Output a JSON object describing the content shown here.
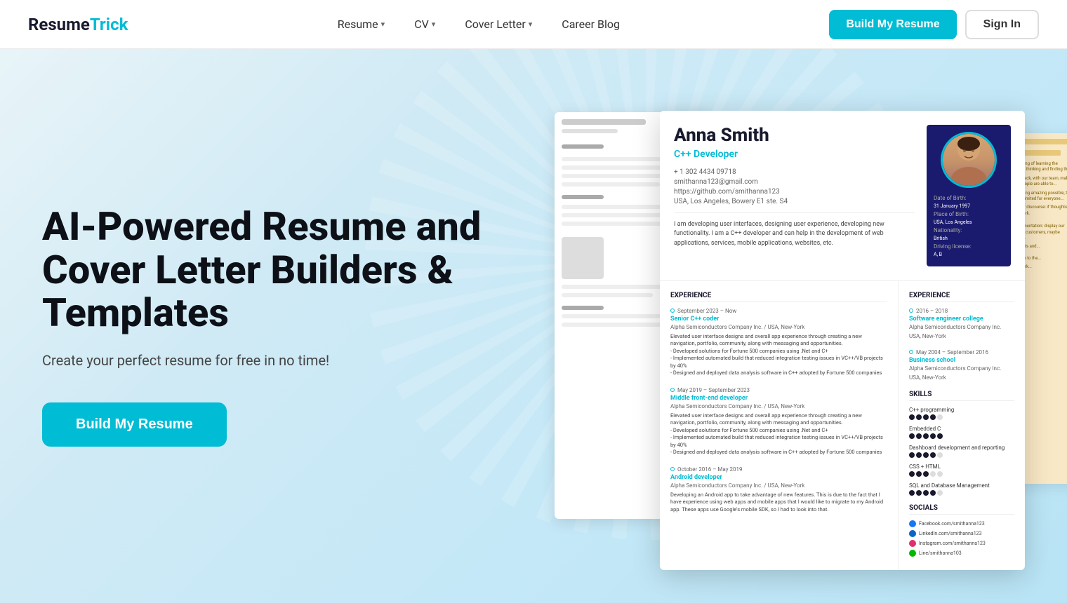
{
  "logo": {
    "resume": "Resume",
    "trick": "Trick"
  },
  "navbar": {
    "links": [
      {
        "id": "resume",
        "label": "Resume",
        "hasDropdown": true
      },
      {
        "id": "cv",
        "label": "CV",
        "hasDropdown": true
      },
      {
        "id": "cover-letter",
        "label": "Cover Letter",
        "hasDropdown": true
      },
      {
        "id": "career-blog",
        "label": "Career Blog",
        "hasDropdown": false
      }
    ],
    "build_button": "Build My Resume",
    "signin_button": "Sign In"
  },
  "hero": {
    "title": "AI-Powered Resume and Cover Letter Builders & Templates",
    "subtitle": "Create your perfect resume for free in no time!",
    "cta_button": "Build My Resume"
  },
  "resume_preview": {
    "name": "Anna Smith",
    "job_title": "C++ Developer",
    "phone": "+ 1 302 4434 09718",
    "email": "smithanna123@gmail.com",
    "github": "https://github.com/smithanna123",
    "address": "USA, Los Angeles, Bowery E1 ste. S4",
    "summary": "I am developing user interfaces, designing user experience, developing new functionality. I am a C++ developer and can help in the development of web applications, services, mobile applications, websites, etc.",
    "personal": {
      "dob_label": "Date of Birth:",
      "dob_value": "31 January 1997",
      "pob_label": "Place of Birth:",
      "pob_value": "USA, Los Angeles",
      "nationality_label": "Nationality:",
      "nationality_value": "British",
      "license_label": "Driving license:",
      "license_value": "A, B"
    },
    "experience": [
      {
        "date": "September 2023 – Now",
        "role": "Senior C++ coder",
        "company": "Alpha Semiconductors Company Inc. / USA, New-York",
        "desc": "Elevated user interface designs and overall app experience through creating a new navigation, portfolio, community, along with messaging and opportunities.\n- Developed solutions for Fortune 500 companies using .Net and C+\n- Implemented automated build that reduced integration testing issues in VC++/VB projects by 40%\n- Designed and deployed data analysis software in C++ adopted by Fortune 500 companies"
      },
      {
        "date": "May 2019 – September 2023",
        "role": "Middle front-end developer",
        "company": "Alpha Semiconductors Company Inc. / USA, New-York",
        "desc": "Elevated user interface designs and overall app experience through creating a new navigation, portfolio, community, along with messaging and opportunities.\n- Developed solutions for Fortune 500 companies using .Net and C+\n- Implemented automated build that reduced integration testing issues in VC++/VB projects by 40%\n- Designed and deployed data analysis software in C++ adopted by Fortune 500 companies"
      },
      {
        "date": "October 2016 – May 2019",
        "role": "Android developer",
        "company": "Alpha Semiconductors Company Inc. / USA, New-York",
        "desc": "Developing an Android app to take advantage of new features. This is due to the fact that I have experience using web apps and mobile apps that I would like to migrate to my Android app. These apps use Google's mobile SDK, so I had to look into that."
      }
    ],
    "edu_experience": [
      {
        "period": "2016 – 2018",
        "institution": "Software engineer college",
        "company": "Alpha Semiconductors Company Inc.",
        "location": "USA, New-York"
      },
      {
        "period": "May 2004 – September 2016",
        "institution": "Business school",
        "company": "Alpha Semiconductors Company Inc.",
        "location": "USA, New-York"
      }
    ],
    "skills": [
      {
        "name": "C++ programming",
        "filled": 4,
        "empty": 1
      },
      {
        "name": "Embedded C",
        "filled": 5,
        "empty": 0
      },
      {
        "name": "Dashboard development and reporting",
        "filled": 4,
        "empty": 1
      },
      {
        "name": "CSS + HTML",
        "filled": 3,
        "empty": 2
      },
      {
        "name": "SQL and Database Management",
        "filled": 4,
        "empty": 1
      }
    ],
    "socials": [
      {
        "label": "Facebook.com/smithanna123",
        "color": "#1877f2"
      },
      {
        "label": "LinkedIn.com/smithanna123",
        "color": "#0a66c2"
      },
      {
        "label": "Instagram.com/smithanna123",
        "color": "#e1306c"
      },
      {
        "label": "Line/smithanna103",
        "color": "#00b900"
      }
    ]
  }
}
